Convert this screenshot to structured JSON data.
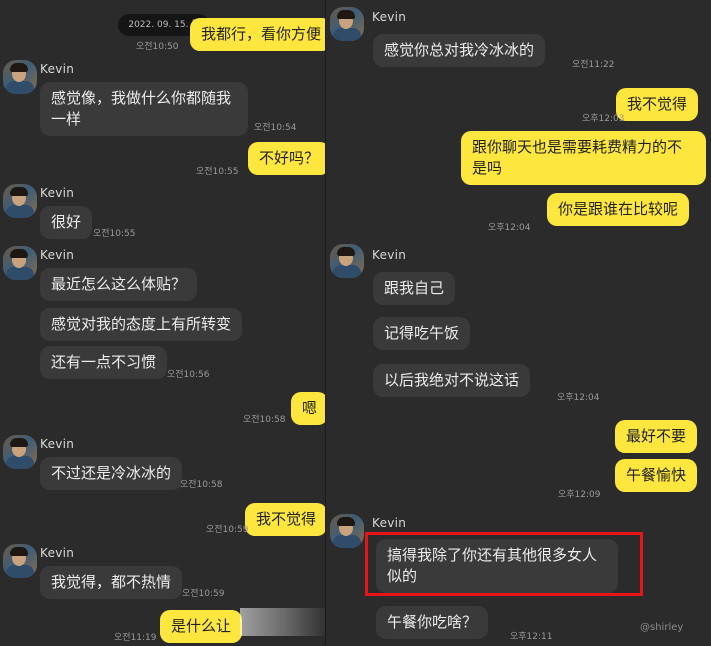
{
  "contact_name": "Kevin",
  "date_chip": "2022. 09. 15. 목",
  "watermark": "@shirley",
  "left": {
    "b1": "我都行，看你方便",
    "t1": "오전10:50",
    "b2": "感觉像，我做什么你都随我一样",
    "t2": "오전10:54",
    "b3": "不好吗？",
    "t3": "오전10:55",
    "b4": "很好",
    "t4": "오전10:55",
    "b5": "最近怎么这么体贴？",
    "b6": "感觉对我的态度上有所转变",
    "b7": "还有一点不习惯",
    "t7": "오전10:56",
    "b8": "嗯",
    "t8": "오전10:58",
    "b9": "不过还是冷冰冰的",
    "t9": "오전10:58",
    "b10": "我不觉得",
    "t10": "오전10:59",
    "b11": "我觉得，都不热情",
    "t11": "오전10:59",
    "b12": "是什么让",
    "t12": "오전11:19"
  },
  "right": {
    "r1": "感觉你总对我冷冰冰的",
    "rt1": "오전11:22",
    "r2": "我不觉得",
    "rt2": "오후12:03",
    "r3": "跟你聊天也是需要耗费精力的不是吗",
    "r4": "你是跟谁在比较呢",
    "rt4": "오후12:04",
    "r5": "跟我自己",
    "r6": "记得吃午饭",
    "r7": "以后我绝对不说这话",
    "rt7": "오후12:04",
    "r8": "最好不要",
    "r9": "午餐愉快",
    "rt9": "오후12:09",
    "r10": "搞得我除了你还有其他很多女人似的",
    "r11": "午餐你吃啥？",
    "rt11": "오후12:11"
  },
  "colors": {
    "background": "#2b2b2b",
    "incoming_bubble": "#3a3a3a",
    "outgoing_bubble": "#fde73f",
    "highlight_border": "#e8141b"
  }
}
